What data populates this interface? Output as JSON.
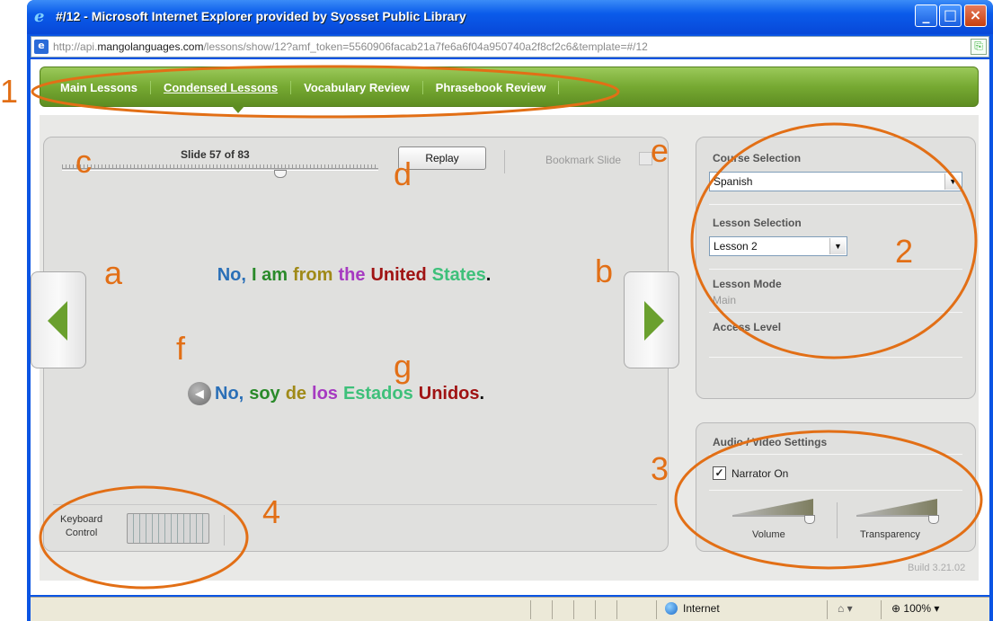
{
  "window": {
    "title": "#/12 - Microsoft Internet Explorer provided by Syosset Public Library",
    "address_prefix": "http://api.",
    "address_domain": "mangolanguages.com",
    "address_rest": "/lessons/show/12?amf_token=5560906facab21a7fe6a6f04a950740a2f8cf2c6&template=#/12"
  },
  "nav": {
    "items": [
      {
        "label": "Main Lessons"
      },
      {
        "label": "Condensed Lessons"
      },
      {
        "label": "Vocabulary Review"
      },
      {
        "label": "Phrasebook Review"
      }
    ]
  },
  "lesson": {
    "slide_label": "Slide 57 of 83",
    "slide_progress": 0.69,
    "replay_label": "Replay",
    "bookmark_label": "Bookmark Slide",
    "english": [
      {
        "text": "No,",
        "color": "#2a6fb7"
      },
      {
        "text": "I am",
        "color": "#2a8a2a"
      },
      {
        "text": "from",
        "color": "#a08a18"
      },
      {
        "text": "the",
        "color": "#a63ac1"
      },
      {
        "text": "United",
        "color": "#a01313"
      },
      {
        "text": "States",
        "color": "#3ec07a"
      },
      {
        "text": ".",
        "color": "#111111"
      }
    ],
    "spanish": [
      {
        "text": "No,",
        "color": "#2a6fb7"
      },
      {
        "text": "soy",
        "color": "#2a8a2a"
      },
      {
        "text": "de",
        "color": "#a08a18"
      },
      {
        "text": "los",
        "color": "#a63ac1"
      },
      {
        "text": "Estados",
        "color": "#3ec07a"
      },
      {
        "text": "Unidos",
        "color": "#a01313"
      },
      {
        "text": ".",
        "color": "#111111"
      }
    ],
    "keyboard_label_1": "Keyboard",
    "keyboard_label_2": "Control"
  },
  "course": {
    "course_label": "Course Selection",
    "course_value": "Spanish",
    "lesson_label": "Lesson Selection",
    "lesson_value": "Lesson 2",
    "mode_label": "Lesson Mode",
    "mode_value": "Main",
    "access_label": "Access Level"
  },
  "av": {
    "title": "Audio / Video Settings",
    "narrator_label": "Narrator On",
    "narrator_checked": true,
    "volume_label": "Volume",
    "transparency_label": "Transparency"
  },
  "build": "Build 3.21.02",
  "status": {
    "zone": "Internet",
    "zoom": "100%"
  },
  "annotations": {
    "n1": "1",
    "n2": "2",
    "n3": "3",
    "n4": "4",
    "a": "a",
    "b": "b",
    "c": "c",
    "d": "d",
    "e": "e",
    "f": "f",
    "g": "g"
  },
  "colors": {
    "annotation": "#e26f16",
    "nav_green": "#76a932",
    "arrow_green": "#6aa02e"
  }
}
